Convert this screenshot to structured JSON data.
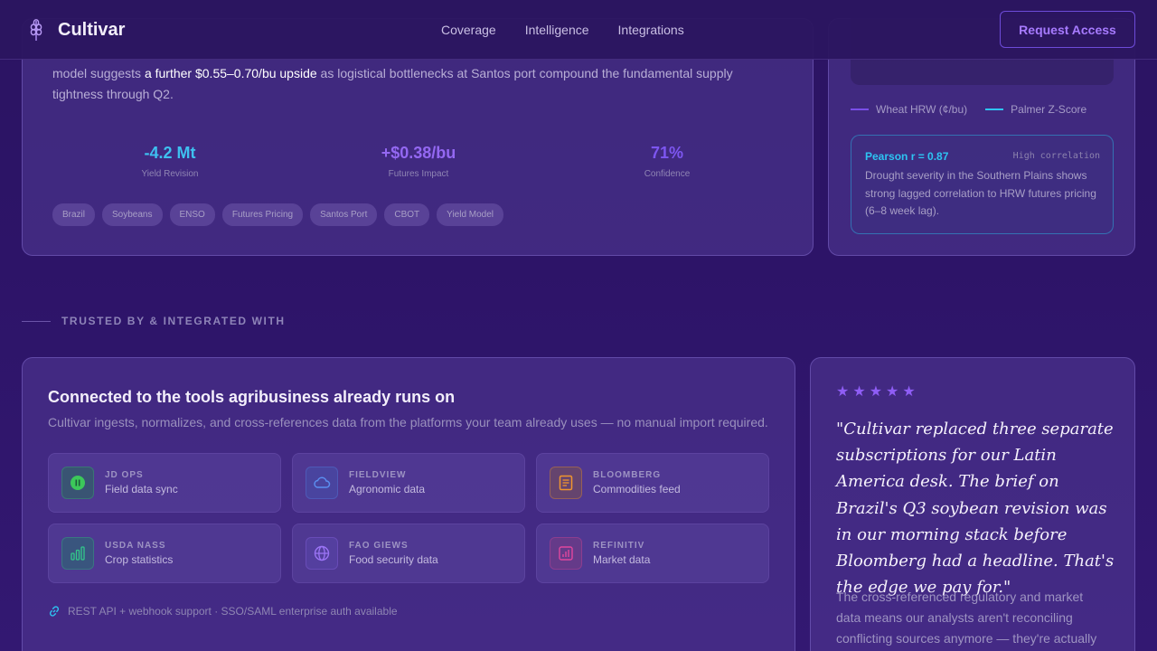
{
  "nav": {
    "brand": "Cultivar",
    "links": [
      "Coverage",
      "Intelligence",
      "Integrations"
    ],
    "cta": "Request Access"
  },
  "brief": {
    "text_before": "model suggests ",
    "text_highlight": "a further $0.55–0.70/bu upside",
    "text_after": " as logistical bottlenecks at Santos port compound the fundamental supply tightness through Q2.",
    "stats": [
      {
        "value": "-4.2 Mt",
        "label": "Yield Revision",
        "color": "#3ec0f0"
      },
      {
        "value": "+$0.38/bu",
        "label": "Futures Impact",
        "color": "#9468f2"
      },
      {
        "value": "71%",
        "label": "Confidence",
        "color": "#7d56f0"
      }
    ],
    "tags": [
      "Brazil",
      "Soybeans",
      "ENSO",
      "Futures Pricing",
      "Santos Port",
      "CBOT",
      "Yield Model"
    ]
  },
  "chart_panel": {
    "legend": [
      {
        "label": "Wheat HRW (¢/bu)",
        "color": "#7a4ee8"
      },
      {
        "label": "Palmer Z-Score",
        "color": "#2dc4f2"
      }
    ],
    "correlation": {
      "title": "Pearson r = 0.87",
      "tag": "High correlation",
      "body": "Drought severity in the Southern Plains shows strong lagged correlation to HRW futures pricing (6–8 week lag)."
    }
  },
  "trusted": {
    "label": "TRUSTED BY & INTEGRATED WITH"
  },
  "integrations": {
    "title": "Connected to the tools agribusiness already runs on",
    "subtitle": "Cultivar ingests, normalizes, and cross-references data from the platforms your team already uses — no manual import required.",
    "items": [
      {
        "name": "JD OPS",
        "desc": "Field data sync",
        "icon": "john-deere-icon",
        "color": "#3cc85a"
      },
      {
        "name": "FIELDVIEW",
        "desc": "Agronomic data",
        "icon": "cloud-icon",
        "color": "#5b8ef0"
      },
      {
        "name": "BLOOMBERG",
        "desc": "Commodities feed",
        "icon": "terminal-icon",
        "color": "#f0952e"
      },
      {
        "name": "USDA NASS",
        "desc": "Crop statistics",
        "icon": "bar-chart-icon",
        "color": "#33c98a"
      },
      {
        "name": "FAO GIEWS",
        "desc": "Food security data",
        "icon": "globe-icon",
        "color": "#9b74f5"
      },
      {
        "name": "REFINITIV",
        "desc": "Market data",
        "icon": "market-chart-icon",
        "color": "#e0479e"
      }
    ],
    "footer": "REST API + webhook support · SSO/SAML enterprise auth available"
  },
  "testimonial": {
    "rating": 5,
    "quote": "\"Cultivar replaced three separate subscriptions for our Latin America desk. The brief on Brazil's Q3 soybean revision was in our morning stack before Bloomberg had a headline. That's the edge we pay for.\"",
    "body": "The cross-referenced regulatory and market data means our analysts aren't reconciling conflicting sources anymore — they're actually"
  }
}
